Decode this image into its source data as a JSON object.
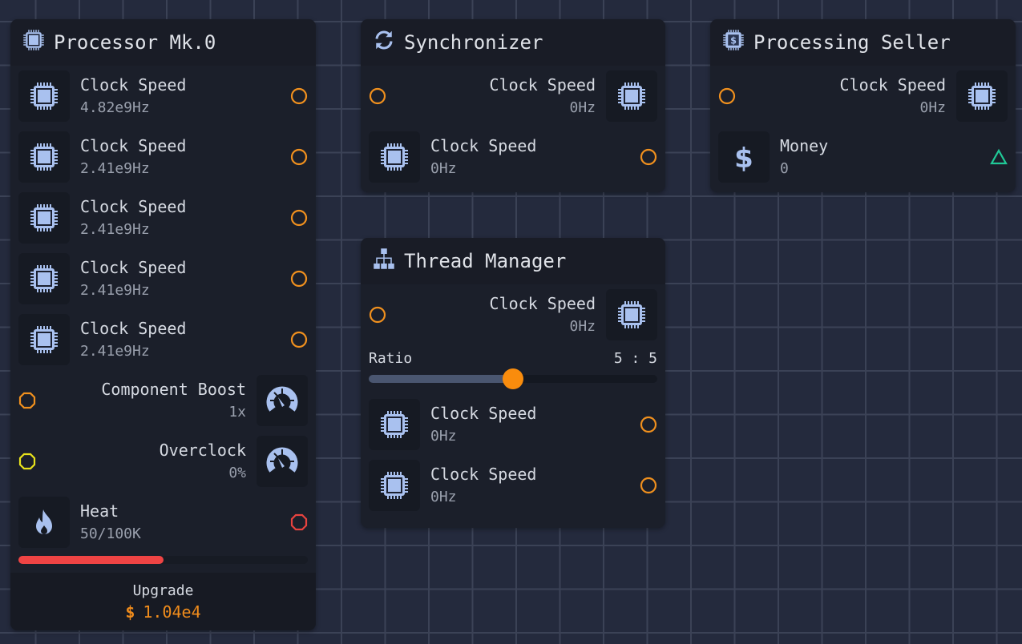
{
  "colors": {
    "accent": "#f98c0d",
    "icon": "#a9c1ef",
    "heat": "#ef4444",
    "money_port": "#20c997",
    "overclock_port": "#e8e21c"
  },
  "nodes": [
    {
      "id": "processor",
      "title": "Processor Mk.0",
      "icon": "chip-icon",
      "rows": [
        {
          "side": "l",
          "icon": "chip-icon",
          "label": "Clock Speed",
          "value": "4.82e9Hz",
          "port": "circle-orange"
        },
        {
          "side": "l",
          "icon": "chip-icon",
          "label": "Clock Speed",
          "value": "2.41e9Hz",
          "port": "circle-orange"
        },
        {
          "side": "l",
          "icon": "chip-icon",
          "label": "Clock Speed",
          "value": "2.41e9Hz",
          "port": "circle-orange"
        },
        {
          "side": "l",
          "icon": "chip-icon",
          "label": "Clock Speed",
          "value": "2.41e9Hz",
          "port": "circle-orange"
        },
        {
          "side": "l",
          "icon": "chip-icon",
          "label": "Clock Speed",
          "value": "2.41e9Hz",
          "port": "circle-orange"
        },
        {
          "side": "r",
          "icon": "gauge-icon",
          "label": "Component Boost",
          "value": "1x",
          "port": "octagon-orange"
        },
        {
          "side": "r",
          "icon": "gauge-icon",
          "label": "Overclock",
          "value": "0%",
          "port": "octagon-yellow"
        },
        {
          "side": "l",
          "icon": "flame-icon",
          "label": "Heat",
          "value": "50/100K",
          "port": "octagon-red"
        }
      ],
      "heat_fraction": 0.5,
      "upgrade": {
        "label": "Upgrade",
        "currency": "$",
        "price": "1.04e4"
      }
    },
    {
      "id": "synchronizer",
      "title": "Synchronizer",
      "icon": "sync-icon",
      "rows": [
        {
          "side": "r",
          "icon": "chip-icon",
          "label": "Clock Speed",
          "value": "0Hz",
          "port": "circle-orange"
        },
        {
          "side": "l",
          "icon": "chip-icon",
          "label": "Clock Speed",
          "value": "0Hz",
          "port": "circle-orange"
        }
      ]
    },
    {
      "id": "thread-manager",
      "title": "Thread Manager",
      "icon": "sitemap-icon",
      "rows": [
        {
          "side": "r",
          "icon": "chip-icon",
          "label": "Clock Speed",
          "value": "0Hz",
          "port": "circle-orange"
        }
      ],
      "ratio": {
        "label": "Ratio",
        "value": "5 : 5",
        "fraction": 0.5
      },
      "rows_after": [
        {
          "side": "l",
          "icon": "chip-icon",
          "label": "Clock Speed",
          "value": "0Hz",
          "port": "circle-orange"
        },
        {
          "side": "l",
          "icon": "chip-icon",
          "label": "Clock Speed",
          "value": "0Hz",
          "port": "circle-orange"
        }
      ]
    },
    {
      "id": "processing-seller",
      "title": "Processing Seller",
      "icon": "chip-dollar-icon",
      "rows": [
        {
          "side": "r",
          "icon": "chip-icon",
          "label": "Clock Speed",
          "value": "0Hz",
          "port": "circle-orange"
        },
        {
          "side": "l",
          "icon": "dollar-icon",
          "label": "Money",
          "value": "0",
          "port": "triangle-green"
        }
      ]
    }
  ]
}
